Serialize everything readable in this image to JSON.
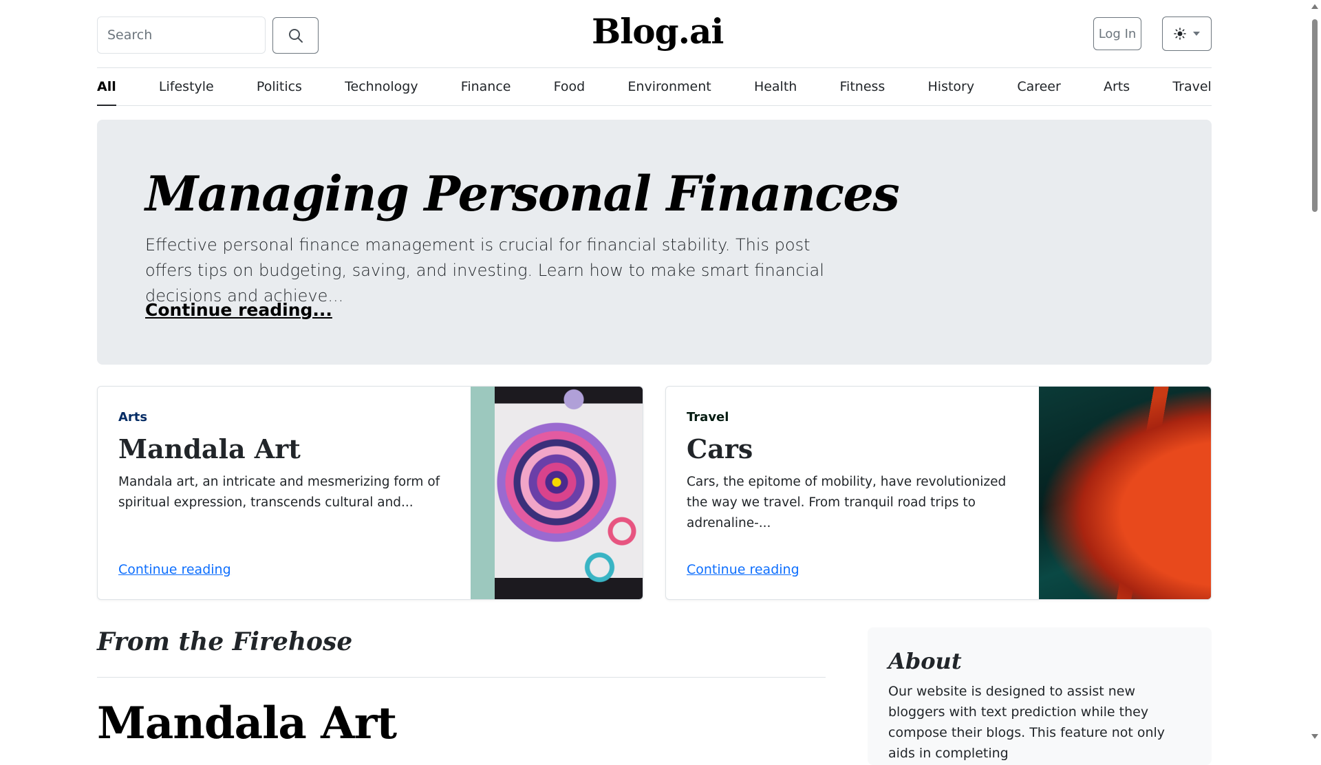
{
  "header": {
    "search_placeholder": "Search",
    "brand": "Blog.ai",
    "login_label": "Log In",
    "search_icon": "search-icon",
    "theme_icon": "sun-icon"
  },
  "nav": {
    "items": [
      "All",
      "Lifestyle",
      "Politics",
      "Technology",
      "Finance",
      "Food",
      "Environment",
      "Health",
      "Fitness",
      "History",
      "Career",
      "Arts",
      "Travel"
    ],
    "active_index": 0
  },
  "hero": {
    "title": "Managing Personal Finances",
    "excerpt": "Effective personal finance management is crucial for financial stability. This post offers tips on budgeting, saving, and investing. Learn how to make smart financial decisions and achieve...",
    "link": "Continue reading..."
  },
  "cards": [
    {
      "category": "Arts",
      "category_color": "#052c65",
      "title": "Mandala Art",
      "excerpt": "Mandala art, an intricate and mesmerizing form of spiritual expression, transcends cultural and...",
      "link": "Continue reading"
    },
    {
      "category": "Travel",
      "category_color": "#051b11",
      "title": "Cars",
      "excerpt": "Cars, the epitome of mobility, have revolutionized the way we travel. From tranquil road trips to adrenaline-...",
      "link": "Continue reading"
    }
  ],
  "firehose": {
    "heading": "From the Firehose",
    "post_title": "Mandala Art"
  },
  "about": {
    "title": "About",
    "text": "Our website is designed to assist new bloggers with text prediction while they compose their blogs. This feature not only aids in completing"
  },
  "colors": {
    "link": "#0d6efd",
    "hero_bg": "#e9ecef",
    "about_bg": "#f8f9fa"
  }
}
